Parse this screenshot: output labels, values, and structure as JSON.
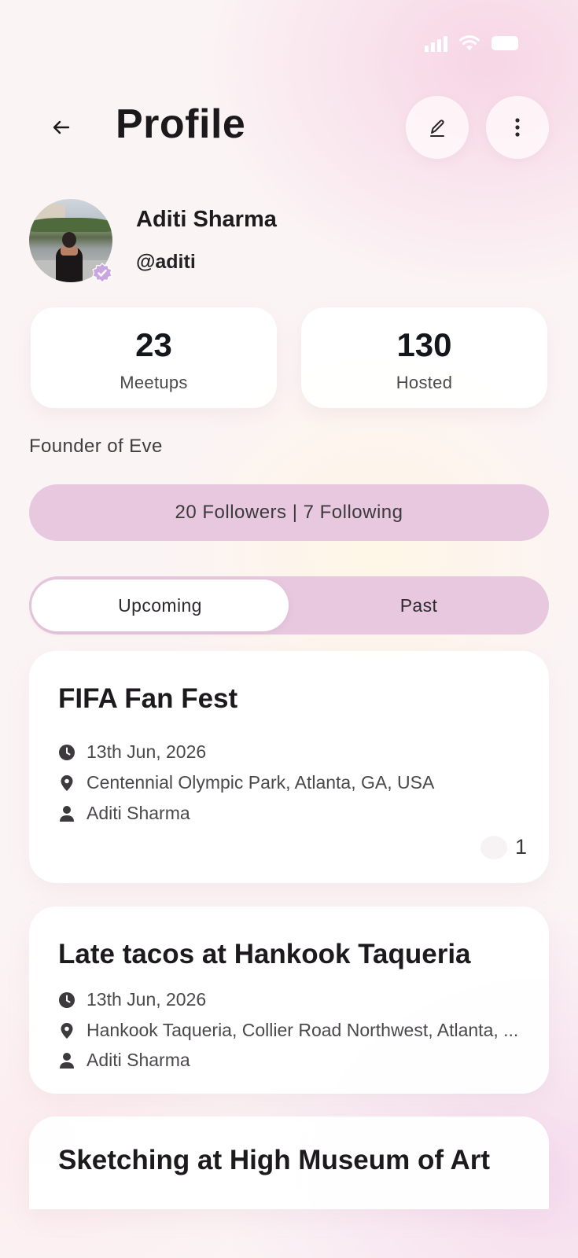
{
  "header": {
    "title": "Profile",
    "icons": {
      "back": "back-arrow-icon",
      "edit": "pencil-icon",
      "more": "more-vertical-icon"
    }
  },
  "status_bar": {
    "icons": [
      "signal-icon",
      "wifi-icon",
      "battery-icon"
    ]
  },
  "profile": {
    "name": "Aditi Sharma",
    "handle": "@aditi",
    "bio": "Founder of Eve",
    "verified": true,
    "avatar_icon": "profile-photo"
  },
  "stats": [
    {
      "value": "23",
      "label": "Meetups"
    },
    {
      "value": "130",
      "label": "Hosted"
    }
  ],
  "follow": {
    "text": "20 Followers | 7 Following"
  },
  "tabs": [
    {
      "label": "Upcoming",
      "active": true
    },
    {
      "label": "Past",
      "active": false
    }
  ],
  "events": [
    {
      "title": "FIFA Fan Fest",
      "date": "13th Jun, 2026",
      "location": "Centennial Olympic Park, Atlanta, GA, USA",
      "host": "Aditi Sharma",
      "count": "1"
    },
    {
      "title": "Late tacos at Hankook Taqueria",
      "date": "13th Jun, 2026",
      "location": "Hankook Taqueria, Collier Road Northwest, Atlanta, ...",
      "host": "Aditi Sharma"
    },
    {
      "title": "Sketching at High Museum of Art"
    }
  ],
  "colors": {
    "accent_pill": "#e7c8de",
    "verified": "#c9a6e0",
    "text_primary": "#1c1a1d"
  }
}
